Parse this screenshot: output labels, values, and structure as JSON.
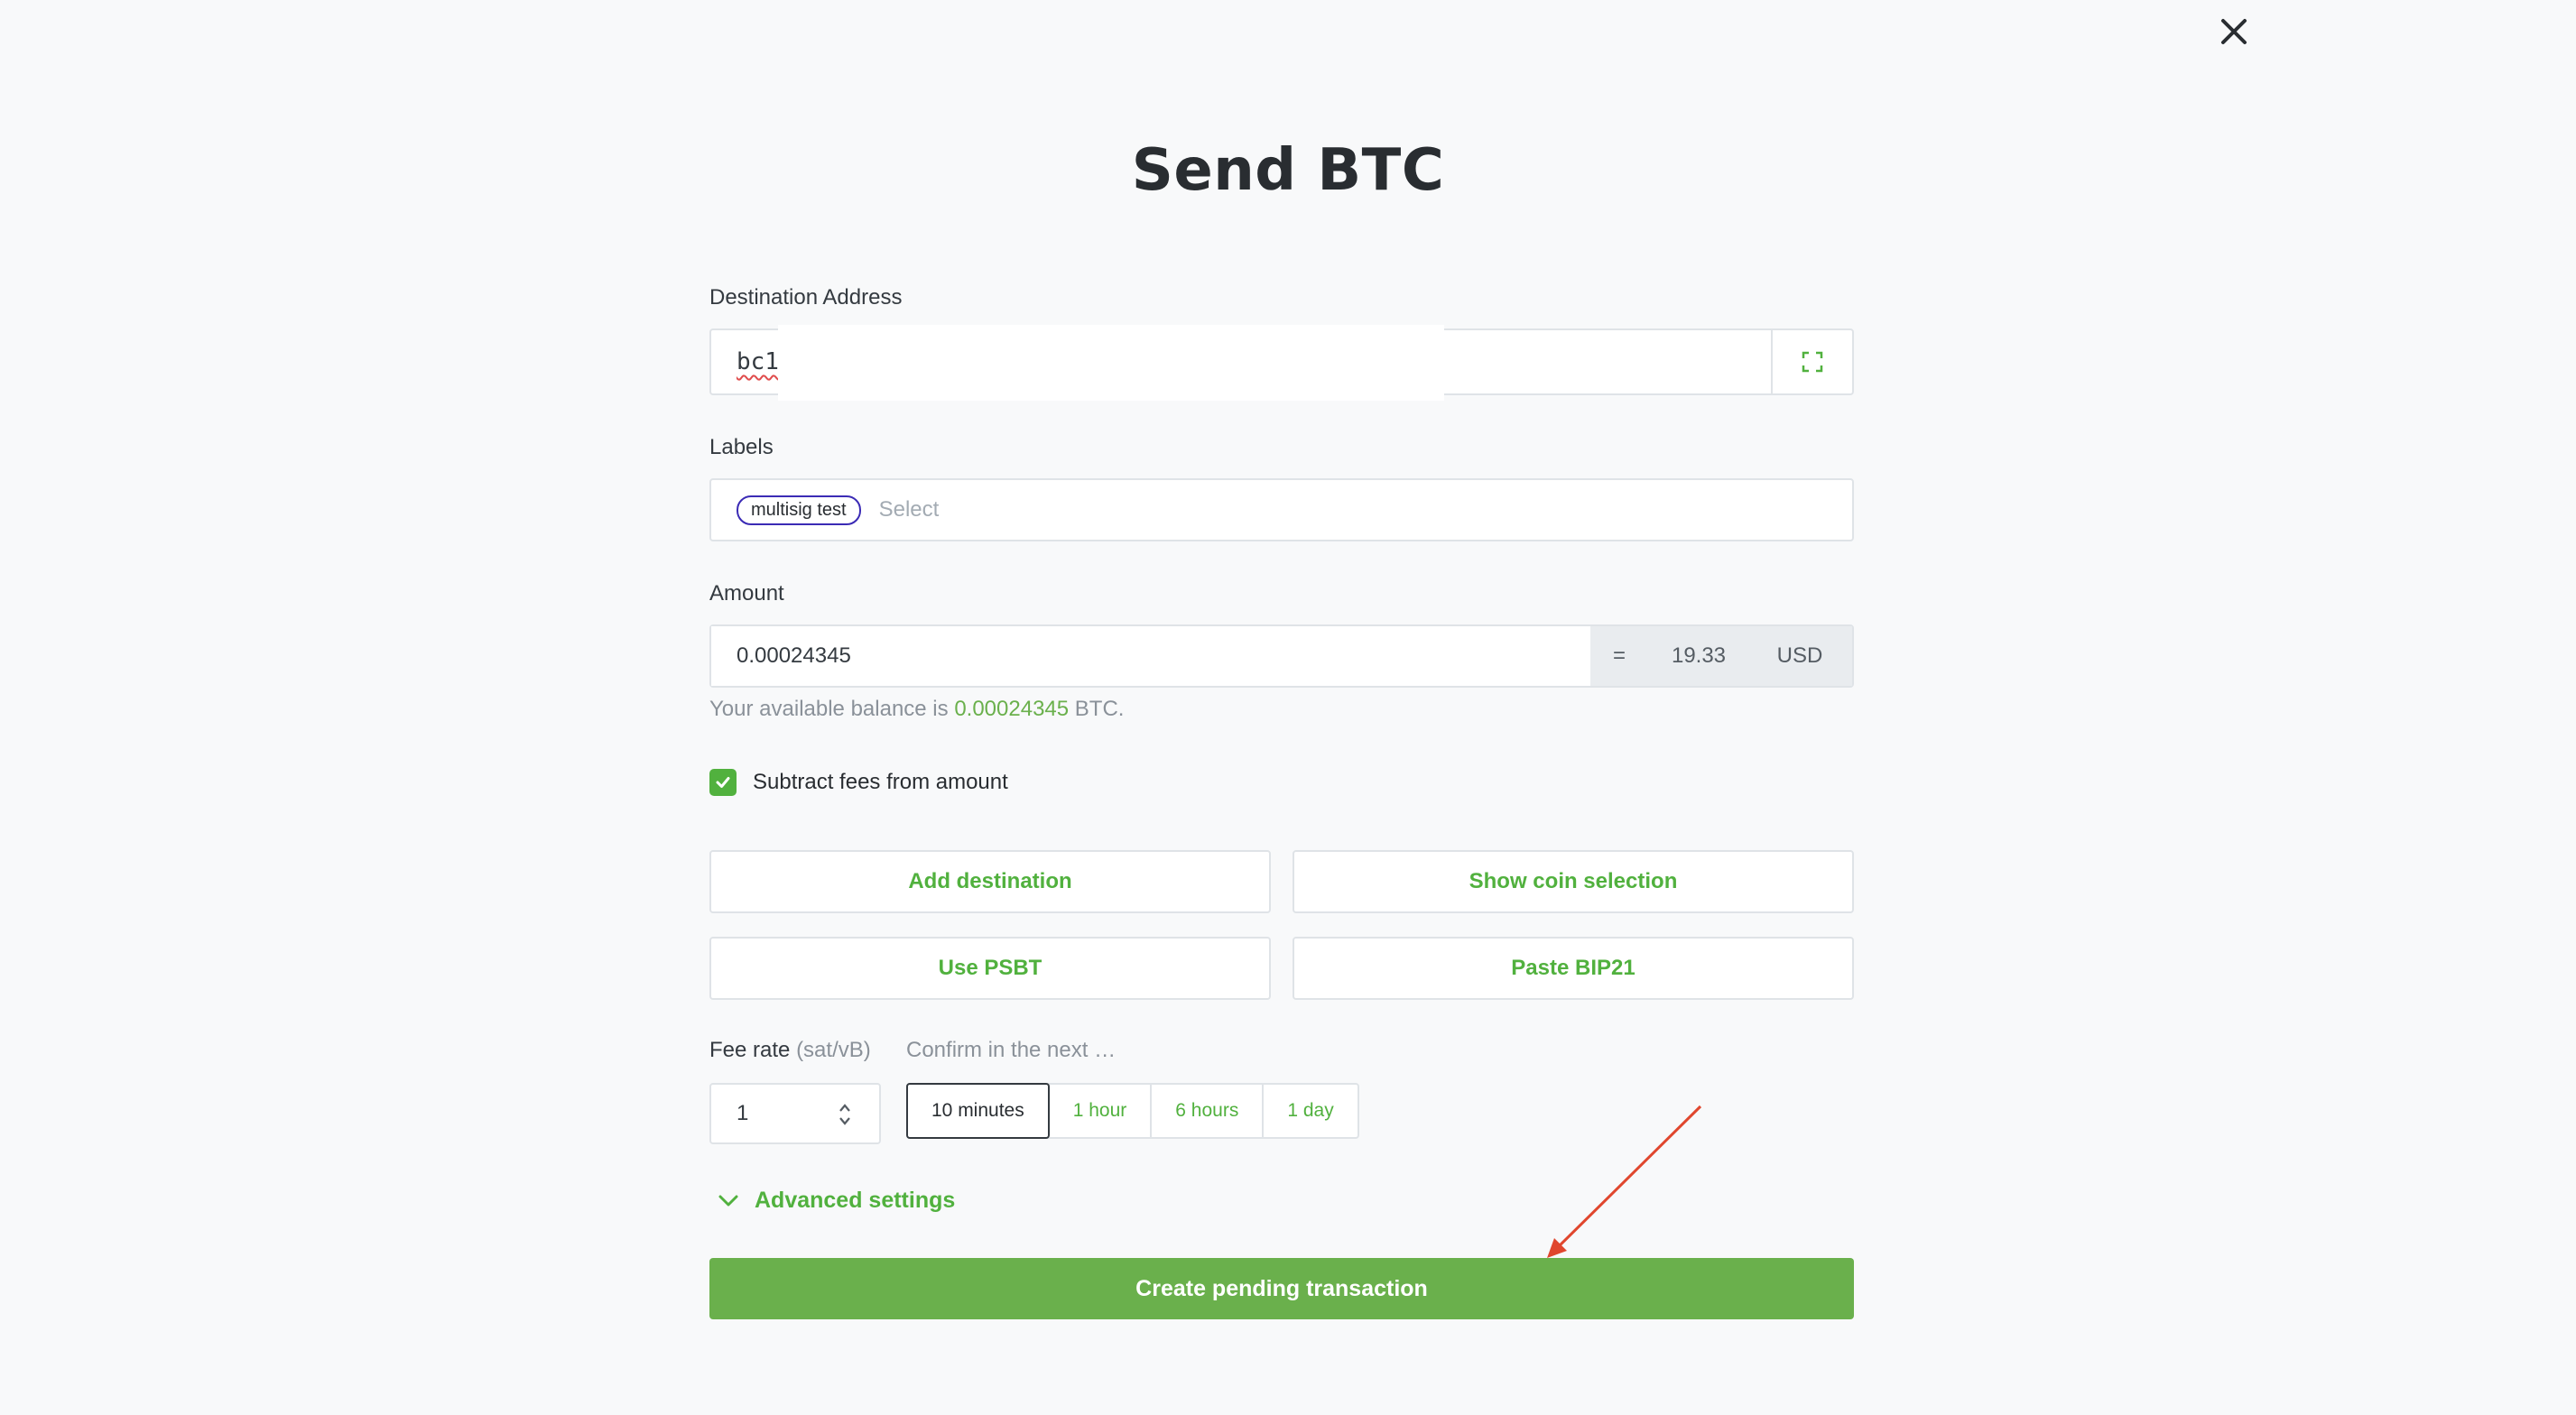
{
  "title": "Send BTC",
  "destination": {
    "label": "Destination Address",
    "value": "bc1"
  },
  "labels": {
    "label": "Labels",
    "tags": [
      "multisig test"
    ],
    "placeholder": "Select"
  },
  "amount": {
    "label": "Amount",
    "value": "0.00024345",
    "equals": "=",
    "fiat_value": "19.33",
    "fiat_currency": "USD"
  },
  "balance": {
    "prefix": "Your available balance is",
    "value": "0.00024345",
    "suffix": "BTC."
  },
  "subtract_fees": {
    "label": "Subtract fees from amount",
    "checked": true
  },
  "buttons": {
    "add_destination": "Add destination",
    "show_coin_selection": "Show coin selection",
    "use_psbt": "Use PSBT",
    "paste_bip21": "Paste BIP21"
  },
  "fee": {
    "label": "Fee rate",
    "unit": "(sat/vB)",
    "value": "1",
    "confirm_label": "Confirm in the next …",
    "options": [
      "10 minutes",
      "1 hour",
      "6 hours",
      "1 day"
    ],
    "selected": "10 minutes"
  },
  "advanced": {
    "label": "Advanced settings"
  },
  "submit": {
    "label": "Create pending transaction"
  },
  "colors": {
    "accent": "#51b13e",
    "primary_button": "#6ab04c",
    "annotation_arrow": "#e0472e"
  }
}
